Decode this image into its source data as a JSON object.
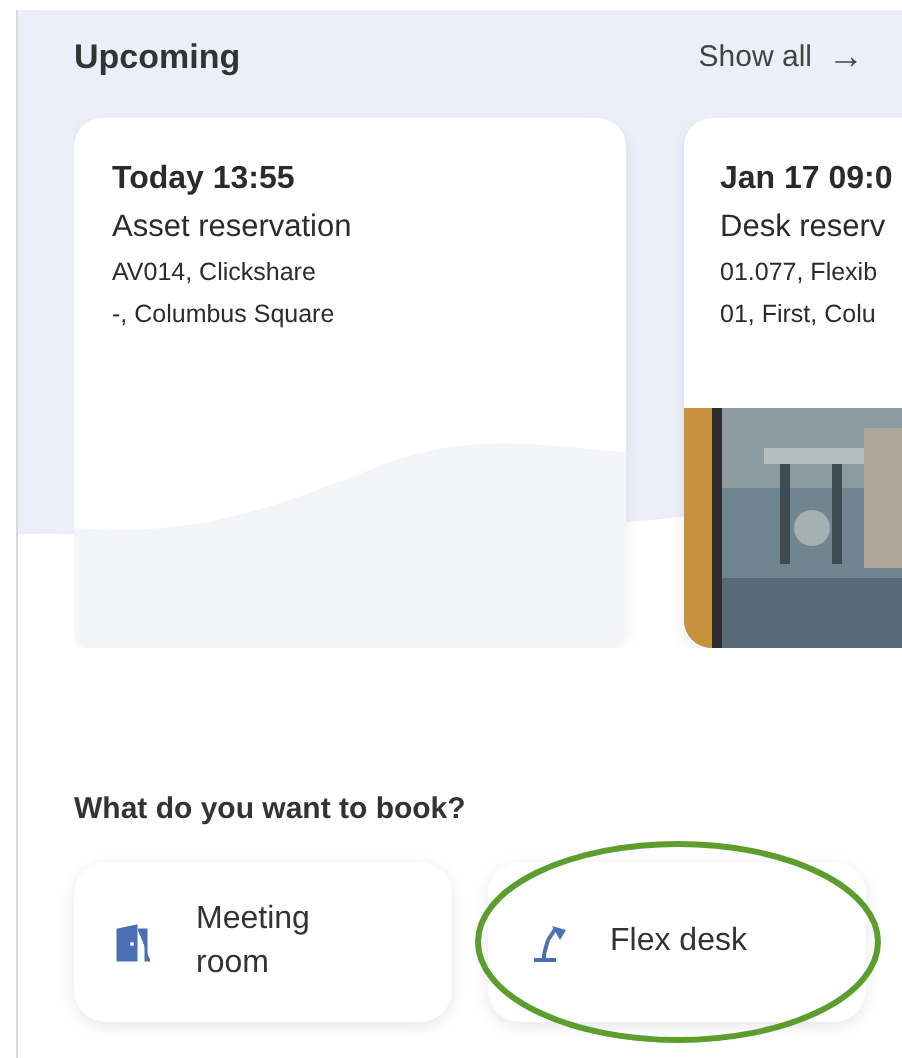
{
  "upcoming": {
    "title": "Upcoming",
    "show_all": "Show all",
    "arrow": "→",
    "cards": [
      {
        "kind": "plain",
        "time": "Today 13:55",
        "type": "Asset reservation",
        "line_1": "AV014, Clickshare",
        "line_2": "-, Columbus Square"
      },
      {
        "kind": "picture",
        "time": "Jan 17 09:0",
        "type": "Desk reserv",
        "line_1": "01.077, Flexib",
        "line_2": "01, First, Colu"
      }
    ]
  },
  "book": {
    "title": "What do you want to book?",
    "options": [
      {
        "kind": "room",
        "label": "Meeting room",
        "highlighted": false
      },
      {
        "kind": "desk",
        "label": "Flex desk",
        "highlighted": true
      }
    ]
  }
}
